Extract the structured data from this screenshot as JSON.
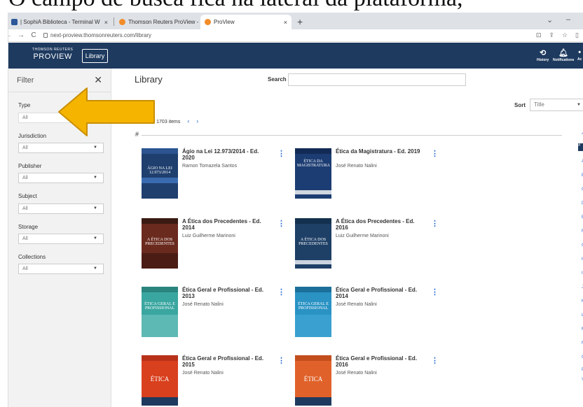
{
  "caption": "O campo de busca fica na lateral da plataforma,",
  "browser": {
    "tabs": [
      {
        "label": "| SophiA Biblioteca - Terminal W",
        "favicon_color": "#2b579a"
      },
      {
        "label": "Thomson Reuters ProView - Libr",
        "favicon_color": "#f28c28"
      },
      {
        "label": "ProView",
        "favicon_color": "#f28c28"
      }
    ],
    "new_tab": "+",
    "url": "next-proview.thomsonreuters.com/library"
  },
  "app": {
    "brand_top": "THOMSON REUTERS",
    "brand_name": "PROVIEW",
    "library_button": "Library",
    "history": "History",
    "notifications": "Notifications",
    "account": "Ac"
  },
  "filter": {
    "title": "Filter",
    "groups": [
      {
        "label": "Type",
        "value": "All"
      },
      {
        "label": "Jurisdiction",
        "value": "All"
      },
      {
        "label": "Publisher",
        "value": "All"
      },
      {
        "label": "Subject",
        "value": "All"
      },
      {
        "label": "Storage",
        "value": "All"
      },
      {
        "label": "Collections",
        "value": "All"
      }
    ]
  },
  "main": {
    "title": "Library",
    "search_label": "Search",
    "sort_label": "Sort",
    "sort_value": "Title",
    "pager_text": "1 to 50 of 1703 items",
    "section": "#"
  },
  "books": [
    {
      "title": "Ágio na Lei 12.973/2014 - Ed. 2020",
      "author": "Ramon Tomazela Santos",
      "cover": "#1f3f6e",
      "cover_text": "ÁGIO NA LEI 12.973/2014"
    },
    {
      "title": "Ética da Magistratura - Ed. 2019",
      "author": "José Renato Nalini",
      "cover": "#1c3d73",
      "cover_text": "ÉTICA DA MAGISTRATURA"
    },
    {
      "title": "A Ética dos Precedentes - Ed. 2014",
      "author": "Luiz Guilherme Marinoni",
      "cover": "#6a2a1e",
      "cover_text": "A ÉTICA DOS PRECEDENTES"
    },
    {
      "title": "A Ética dos Precedentes - Ed. 2016",
      "author": "Luiz Guilherme Marinoni",
      "cover": "#1e3f66",
      "cover_text": "A ÉTICA DOS PRECEDENTES"
    },
    {
      "title": "Ética Geral e Profissional - Ed. 2013",
      "author": "José Renato Nalini",
      "cover": "#3aa6a0",
      "cover_text": "ÉTICA GERAL E PROFISSIONAL"
    },
    {
      "title": "Ética Geral e Profissional - Ed. 2014",
      "author": "José Renato Nalini",
      "cover": "#2a93c4",
      "cover_text": "ÉTICA GERAL E PROFISSIONAL"
    },
    {
      "title": "Ética Geral e Profissional - Ed. 2015",
      "author": "José Renato Nalini",
      "cover": "#d9401e",
      "cover_text": "ÉTICA"
    },
    {
      "title": "Ética Geral e Profissional - Ed. 2016",
      "author": "José Renato Nalini",
      "cover": "#e0622a",
      "cover_text": "ÉTICA"
    }
  ],
  "alpha_index": [
    "^",
    "#",
    "A",
    "B",
    "C",
    "D",
    "E",
    "F",
    "G",
    "H",
    "I",
    "J",
    "K",
    "L",
    "M",
    "N",
    "O",
    "P",
    "V"
  ],
  "colors": {
    "header": "#1e3a5f",
    "link": "#2a6ad1",
    "arrow": "#f5b400"
  }
}
